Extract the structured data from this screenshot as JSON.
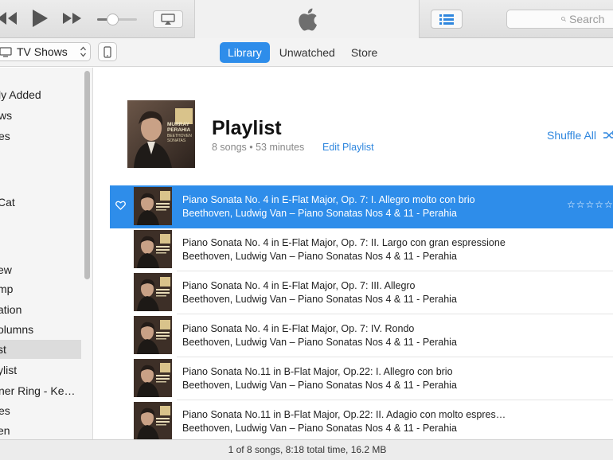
{
  "toolbar": {
    "search_placeholder": "Search",
    "volume_level": 0.35
  },
  "navbar": {
    "media_kind": "TV Shows",
    "tabs": [
      {
        "label": "Library",
        "active": true
      },
      {
        "label": "Unwatched",
        "active": false
      },
      {
        "label": "Store",
        "active": false
      }
    ]
  },
  "sidebar": {
    "items": [
      {
        "label": "ly Added",
        "selected": false
      },
      {
        "label": "ws",
        "selected": false
      },
      {
        "label": "es",
        "selected": false
      },
      {
        "label": "Cat",
        "selected": false
      },
      {
        "label": "ew",
        "selected": false
      },
      {
        "label": "mp",
        "selected": false
      },
      {
        "label": "ation",
        "selected": false
      },
      {
        "label": "olumns",
        "selected": false
      },
      {
        "label": "st",
        "selected": true
      },
      {
        "label": "ylist",
        "selected": false
      },
      {
        "label": "ner Ring - Ke…",
        "selected": false
      },
      {
        "label": "es",
        "selected": false
      },
      {
        "label": "en",
        "selected": false
      }
    ]
  },
  "playlist": {
    "title": "Playlist",
    "meta": "8 songs • 53 minutes",
    "edit_label": "Edit Playlist",
    "shuffle_label": "Shuffle All",
    "artwork_text": [
      "MURRAY",
      "PERAHIA",
      "BEETHOVEN",
      "SONATAS"
    ]
  },
  "songs": [
    {
      "title": "Piano Sonata No. 4 in E-Flat Major, Op. 7: I. Allegro molto con brio",
      "subtitle": "Beethoven, Ludwig Van – Piano Sonatas Nos 4 & 11 - Perahia",
      "selected": true,
      "stars": "☆☆☆☆☆"
    },
    {
      "title": "Piano Sonata No. 4 in E-Flat Major, Op. 7: II. Largo con gran espressione",
      "subtitle": "Beethoven, Ludwig Van – Piano Sonatas Nos 4 & 11 - Perahia",
      "selected": false,
      "stars": ""
    },
    {
      "title": "Piano Sonata No. 4 in E-Flat Major, Op. 7: III. Allegro",
      "subtitle": "Beethoven, Ludwig Van – Piano Sonatas Nos 4 & 11 - Perahia",
      "selected": false,
      "stars": ""
    },
    {
      "title": "Piano Sonata No. 4 in E-Flat Major, Op. 7: IV. Rondo",
      "subtitle": "Beethoven, Ludwig Van – Piano Sonatas Nos 4 & 11 - Perahia",
      "selected": false,
      "stars": ""
    },
    {
      "title": "Piano Sonata No.11 in B-Flat Major, Op.22: I. Allegro con brio",
      "subtitle": "Beethoven, Ludwig Van – Piano Sonatas Nos 4 & 11 - Perahia",
      "selected": false,
      "stars": ""
    },
    {
      "title": "Piano Sonata No.11 in B-Flat Major, Op.22: II. Adagio con molto espres…",
      "subtitle": "Beethoven, Ludwig Van – Piano Sonatas Nos 4 & 11 - Perahia",
      "selected": false,
      "stars": ""
    }
  ],
  "status": {
    "text": "1 of 8 songs, 8:18 total time, 16.2 MB"
  },
  "colors": {
    "accent": "#2e8dea",
    "link": "#2e86de",
    "sidebar_bg": "#f5f5f5",
    "toolbar_bg": "#e4e4e4"
  },
  "icons": [
    "rewind-icon",
    "play-icon",
    "fast-forward-icon",
    "volume-slider",
    "airplay-icon",
    "apple-logo-icon",
    "list-view-icon",
    "search-icon",
    "tv-icon",
    "stepper-icon",
    "device-icon",
    "heart-icon",
    "shuffle-icon"
  ]
}
